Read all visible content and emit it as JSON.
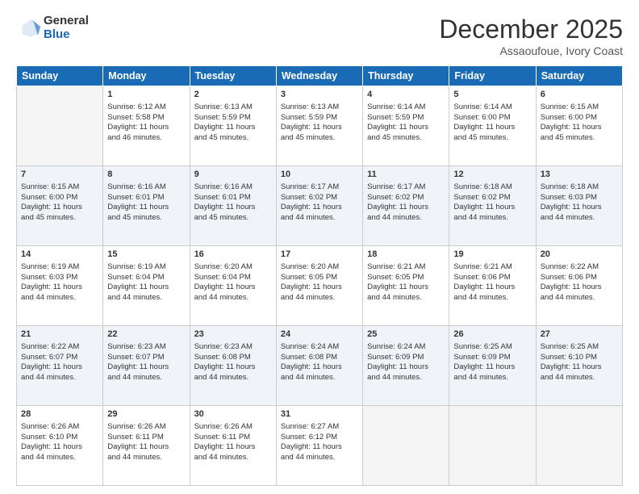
{
  "logo": {
    "general": "General",
    "blue": "Blue"
  },
  "title": "December 2025",
  "location": "Assaoufoue, Ivory Coast",
  "days_header": [
    "Sunday",
    "Monday",
    "Tuesday",
    "Wednesday",
    "Thursday",
    "Friday",
    "Saturday"
  ],
  "weeks": [
    [
      {
        "day": "",
        "info": ""
      },
      {
        "day": "1",
        "info": "Sunrise: 6:12 AM\nSunset: 5:58 PM\nDaylight: 11 hours\nand 46 minutes."
      },
      {
        "day": "2",
        "info": "Sunrise: 6:13 AM\nSunset: 5:59 PM\nDaylight: 11 hours\nand 45 minutes."
      },
      {
        "day": "3",
        "info": "Sunrise: 6:13 AM\nSunset: 5:59 PM\nDaylight: 11 hours\nand 45 minutes."
      },
      {
        "day": "4",
        "info": "Sunrise: 6:14 AM\nSunset: 5:59 PM\nDaylight: 11 hours\nand 45 minutes."
      },
      {
        "day": "5",
        "info": "Sunrise: 6:14 AM\nSunset: 6:00 PM\nDaylight: 11 hours\nand 45 minutes."
      },
      {
        "day": "6",
        "info": "Sunrise: 6:15 AM\nSunset: 6:00 PM\nDaylight: 11 hours\nand 45 minutes."
      }
    ],
    [
      {
        "day": "7",
        "info": "Sunrise: 6:15 AM\nSunset: 6:00 PM\nDaylight: 11 hours\nand 45 minutes."
      },
      {
        "day": "8",
        "info": "Sunrise: 6:16 AM\nSunset: 6:01 PM\nDaylight: 11 hours\nand 45 minutes."
      },
      {
        "day": "9",
        "info": "Sunrise: 6:16 AM\nSunset: 6:01 PM\nDaylight: 11 hours\nand 45 minutes."
      },
      {
        "day": "10",
        "info": "Sunrise: 6:17 AM\nSunset: 6:02 PM\nDaylight: 11 hours\nand 44 minutes."
      },
      {
        "day": "11",
        "info": "Sunrise: 6:17 AM\nSunset: 6:02 PM\nDaylight: 11 hours\nand 44 minutes."
      },
      {
        "day": "12",
        "info": "Sunrise: 6:18 AM\nSunset: 6:02 PM\nDaylight: 11 hours\nand 44 minutes."
      },
      {
        "day": "13",
        "info": "Sunrise: 6:18 AM\nSunset: 6:03 PM\nDaylight: 11 hours\nand 44 minutes."
      }
    ],
    [
      {
        "day": "14",
        "info": "Sunrise: 6:19 AM\nSunset: 6:03 PM\nDaylight: 11 hours\nand 44 minutes."
      },
      {
        "day": "15",
        "info": "Sunrise: 6:19 AM\nSunset: 6:04 PM\nDaylight: 11 hours\nand 44 minutes."
      },
      {
        "day": "16",
        "info": "Sunrise: 6:20 AM\nSunset: 6:04 PM\nDaylight: 11 hours\nand 44 minutes."
      },
      {
        "day": "17",
        "info": "Sunrise: 6:20 AM\nSunset: 6:05 PM\nDaylight: 11 hours\nand 44 minutes."
      },
      {
        "day": "18",
        "info": "Sunrise: 6:21 AM\nSunset: 6:05 PM\nDaylight: 11 hours\nand 44 minutes."
      },
      {
        "day": "19",
        "info": "Sunrise: 6:21 AM\nSunset: 6:06 PM\nDaylight: 11 hours\nand 44 minutes."
      },
      {
        "day": "20",
        "info": "Sunrise: 6:22 AM\nSunset: 6:06 PM\nDaylight: 11 hours\nand 44 minutes."
      }
    ],
    [
      {
        "day": "21",
        "info": "Sunrise: 6:22 AM\nSunset: 6:07 PM\nDaylight: 11 hours\nand 44 minutes."
      },
      {
        "day": "22",
        "info": "Sunrise: 6:23 AM\nSunset: 6:07 PM\nDaylight: 11 hours\nand 44 minutes."
      },
      {
        "day": "23",
        "info": "Sunrise: 6:23 AM\nSunset: 6:08 PM\nDaylight: 11 hours\nand 44 minutes."
      },
      {
        "day": "24",
        "info": "Sunrise: 6:24 AM\nSunset: 6:08 PM\nDaylight: 11 hours\nand 44 minutes."
      },
      {
        "day": "25",
        "info": "Sunrise: 6:24 AM\nSunset: 6:09 PM\nDaylight: 11 hours\nand 44 minutes."
      },
      {
        "day": "26",
        "info": "Sunrise: 6:25 AM\nSunset: 6:09 PM\nDaylight: 11 hours\nand 44 minutes."
      },
      {
        "day": "27",
        "info": "Sunrise: 6:25 AM\nSunset: 6:10 PM\nDaylight: 11 hours\nand 44 minutes."
      }
    ],
    [
      {
        "day": "28",
        "info": "Sunrise: 6:26 AM\nSunset: 6:10 PM\nDaylight: 11 hours\nand 44 minutes."
      },
      {
        "day": "29",
        "info": "Sunrise: 6:26 AM\nSunset: 6:11 PM\nDaylight: 11 hours\nand 44 minutes."
      },
      {
        "day": "30",
        "info": "Sunrise: 6:26 AM\nSunset: 6:11 PM\nDaylight: 11 hours\nand 44 minutes."
      },
      {
        "day": "31",
        "info": "Sunrise: 6:27 AM\nSunset: 6:12 PM\nDaylight: 11 hours\nand 44 minutes."
      },
      {
        "day": "",
        "info": ""
      },
      {
        "day": "",
        "info": ""
      },
      {
        "day": "",
        "info": ""
      }
    ]
  ]
}
